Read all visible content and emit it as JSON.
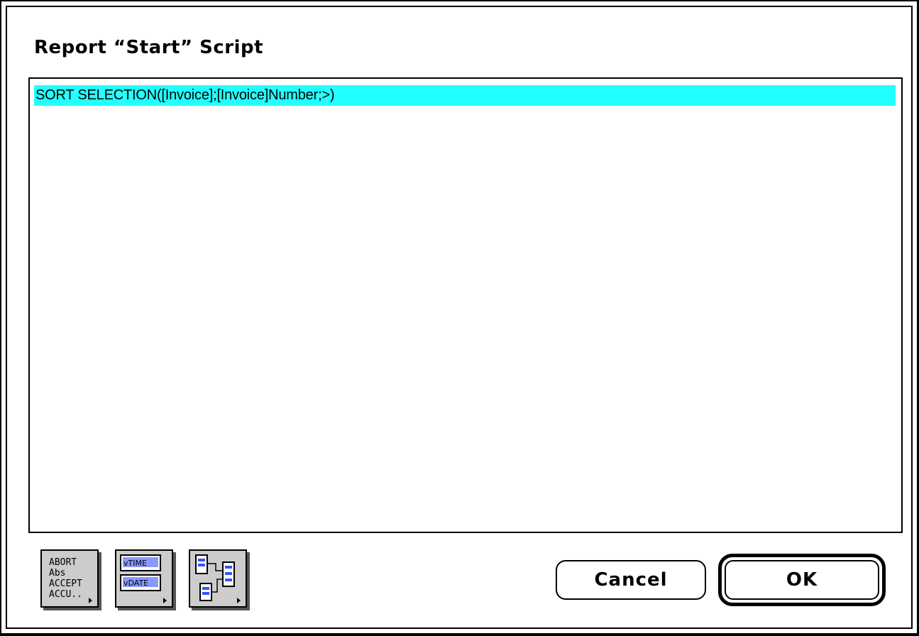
{
  "dialog": {
    "title": "Report “Start” Script"
  },
  "script": {
    "lines": [
      "SORT SELECTION([Invoice];[Invoice]Number;>)"
    ],
    "highlight_color": "#22ffff"
  },
  "toolbar": {
    "commands_palette": {
      "icon": "command-list-icon",
      "lines": [
        "ABORT",
        "Abs",
        "ACCEPT",
        "ACCU.."
      ]
    },
    "fields_palette": {
      "icon": "field-list-icon",
      "lines": [
        "vTIME",
        "vDATE"
      ]
    },
    "tables_palette": {
      "icon": "table-structure-icon"
    }
  },
  "buttons": {
    "cancel_label": "Cancel",
    "ok_label": "OK"
  }
}
